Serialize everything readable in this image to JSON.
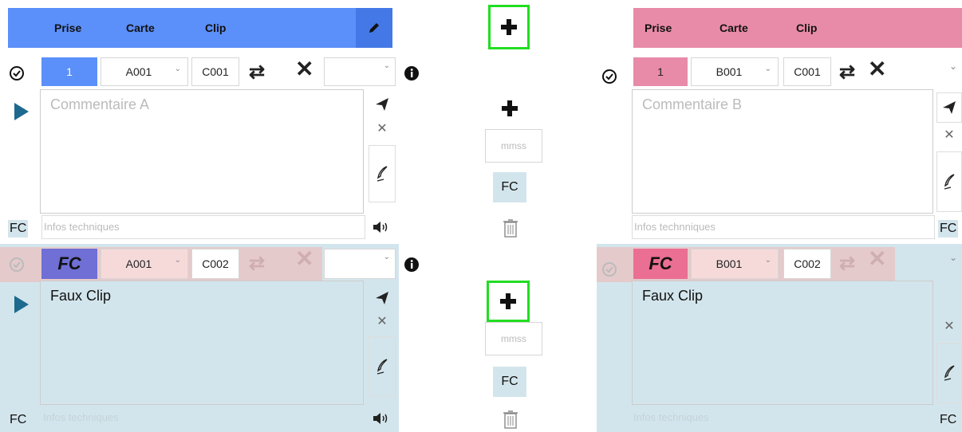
{
  "header": {
    "col1": "Prise",
    "col2": "Carte",
    "col3": "Clip"
  },
  "colors": {
    "blue": "#5b8ff9",
    "pink": "#e88ba8",
    "bluelight": "#d3e5ec",
    "fcpurple": "#6f6fd6",
    "fcpink": "#ea6f92",
    "green": "#22dd22"
  },
  "take1": {
    "a": {
      "prise": "1",
      "carte": "A001",
      "clip": "C001",
      "comment_placeholder": "Commentaire A",
      "info_placeholder": "Infos techniques",
      "fc": "FC"
    },
    "b": {
      "prise": "1",
      "carte": "B001",
      "clip": "C001",
      "comment_placeholder": "Commentaire B",
      "info_placeholder": "Infos technniques",
      "fc": "FC"
    },
    "center": {
      "time_placeholder": "mmss",
      "fc": "FC"
    }
  },
  "take2": {
    "a": {
      "prise": "FC",
      "carte": "A001",
      "clip": "C002",
      "comment": "Faux Clip",
      "info_placeholder": "Infos techniques",
      "fc": "FC"
    },
    "b": {
      "prise": "FC",
      "carte": "B001",
      "clip": "C002",
      "comment": "Faux Clip",
      "info_placeholder": "Infos techniques",
      "fc": "FC"
    },
    "center": {
      "time_placeholder": "mmss",
      "fc": "FC"
    }
  }
}
